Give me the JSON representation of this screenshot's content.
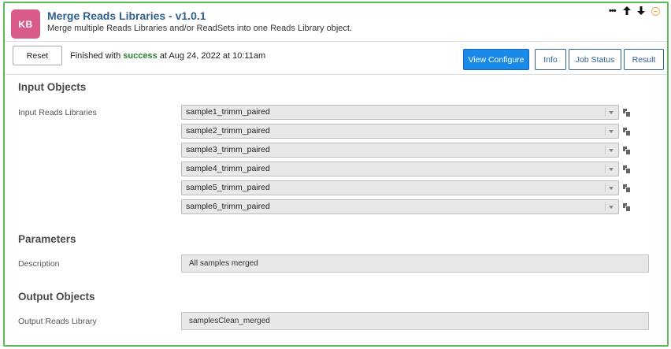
{
  "app": {
    "logo_text": "KB",
    "title": "Merge Reads Libraries - v1.0.1",
    "subtitle": "Merge multiple Reads Libraries and/or ReadSets into one Reads Library object."
  },
  "controls": {
    "menu_icon": "more-dots-icon",
    "up_icon": "arrow-up-icon",
    "down_icon": "arrow-down-icon",
    "collapse_icon": "collapse-icon",
    "menu_glyph": "•••",
    "up_glyph": "🡡",
    "down_glyph": "🡣"
  },
  "toolbar": {
    "reset_label": "Reset",
    "status_prefix": "Finished with",
    "status_word": "success",
    "status_suffix": "at Aug 24, 2022 at 10:11am",
    "view_configure_label": "View Configure",
    "info_label": "Info",
    "job_status_label": "Job Status",
    "result_label": "Result"
  },
  "input_objects": {
    "heading": "Input Objects",
    "label": "Input Reads Libraries",
    "items": [
      "sample1_trimm_paired",
      "sample2_trimm_paired",
      "sample3_trimm_paired",
      "sample4_trimm_paired",
      "sample5_trimm_paired",
      "sample6_trimm_paired"
    ]
  },
  "parameters": {
    "heading": "Parameters",
    "description_label": "Description",
    "description_value": "All samples merged"
  },
  "output_objects": {
    "heading": "Output Objects",
    "label": "Output Reads Library",
    "value": "samplesClean_merged"
  },
  "colors": {
    "accent_border": "#5cb85c",
    "title_blue": "#2e618d",
    "logo_pink": "#d95b8a",
    "primary_button": "#1a8ae8",
    "success_green": "#2e7d32",
    "collapse_orange": "#f0ad4e"
  }
}
